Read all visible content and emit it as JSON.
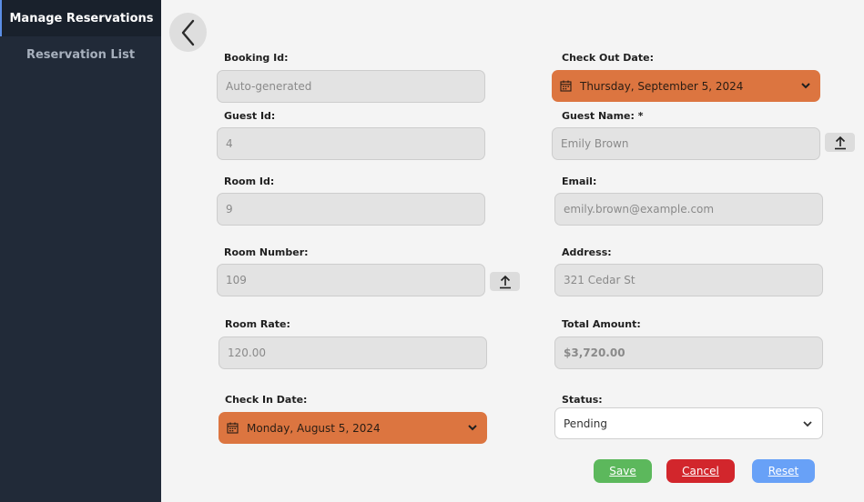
{
  "sidebar": {
    "items": [
      {
        "label": "Manage Reservations"
      },
      {
        "label": "Reservation List"
      }
    ]
  },
  "form": {
    "booking_id": {
      "label": "Booking Id:",
      "placeholder": "Auto-generated"
    },
    "guest_id": {
      "label": "Guest Id:",
      "value": "4"
    },
    "room_id": {
      "label": "Room Id:",
      "value": "9"
    },
    "room_number": {
      "label": "Room Number:",
      "value": "109"
    },
    "room_rate": {
      "label": "Room Rate:",
      "value": "120.00"
    },
    "check_in": {
      "label": "Check In Date:",
      "value": "Monday, August 5, 2024"
    },
    "check_out": {
      "label": "Check Out Date:",
      "value": "Thursday, September 5, 2024"
    },
    "guest_name": {
      "label": "Guest Name: *",
      "value": "Emily Brown"
    },
    "email": {
      "label": "Email:",
      "value": "emily.brown@example.com"
    },
    "address": {
      "label": "Address:",
      "value": "321 Cedar St"
    },
    "total_amount": {
      "label": "Total Amount:",
      "value": "$3,720.00"
    },
    "status": {
      "label": "Status:",
      "value": "Pending"
    }
  },
  "buttons": {
    "save": "Save",
    "cancel": "Cancel",
    "reset": "Reset"
  },
  "icons": {
    "back": "chevron-left-icon",
    "calendar": "calendar-icon",
    "dropdown": "chevron-down-icon",
    "upload": "upload-icon"
  },
  "colors": {
    "sidebar": "#212a38",
    "date_accent": "#dc7540",
    "save": "#5cb85c",
    "cancel": "#d2262c",
    "reset": "#68a1f7"
  }
}
